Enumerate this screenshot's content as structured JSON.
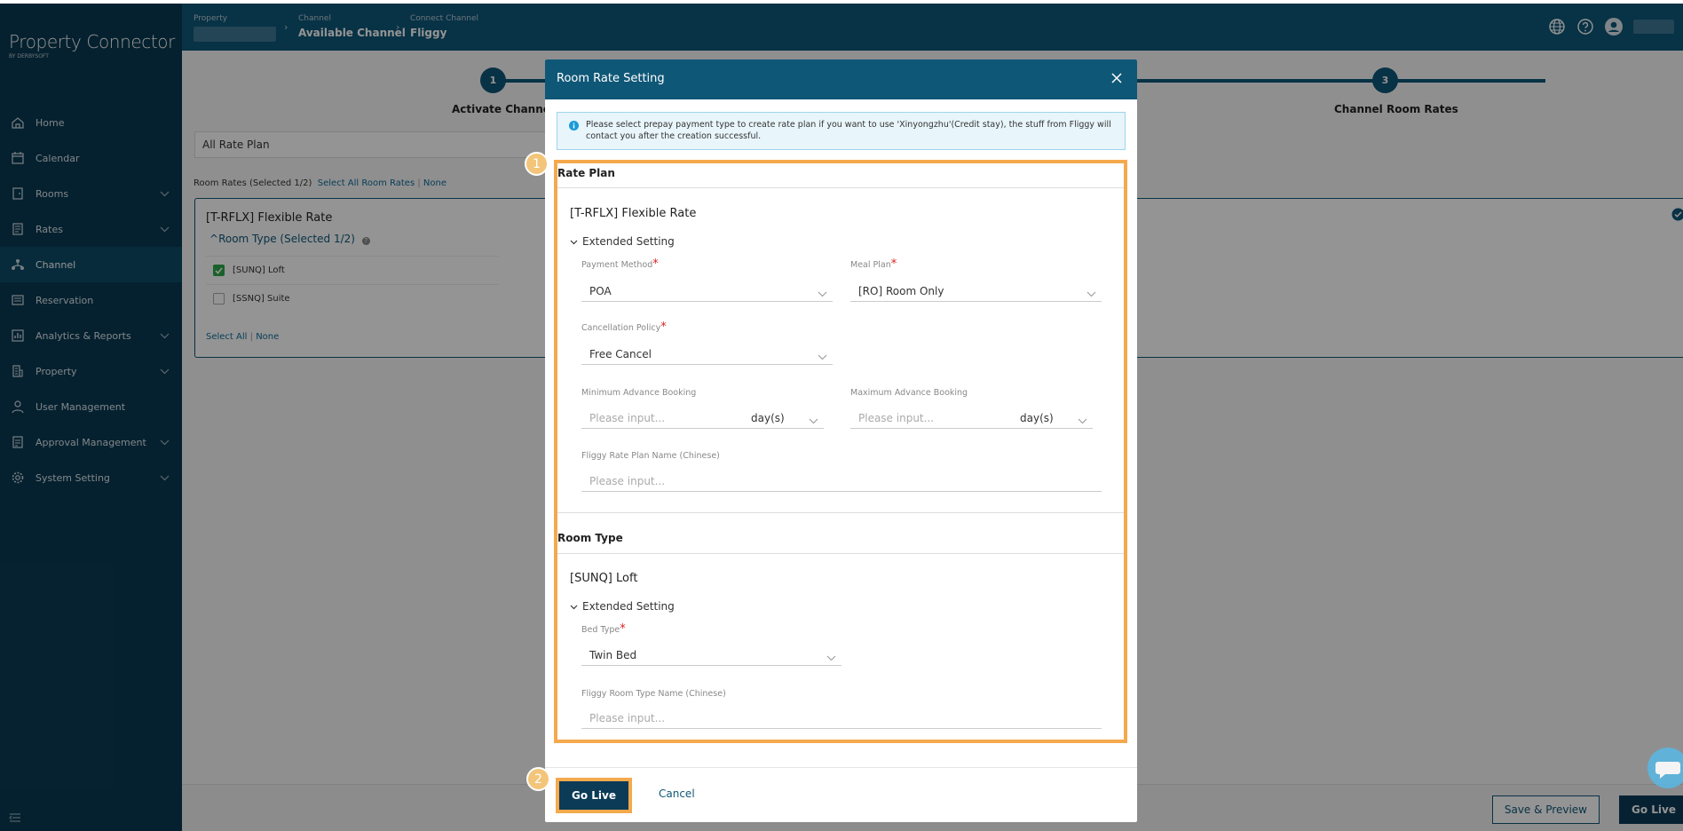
{
  "app": {
    "logo_name": "Property Connector",
    "logo_by": "BY DERBYSOFT"
  },
  "sidebar": {
    "items": [
      {
        "label": "Home",
        "icon": "home-icon",
        "chevron": false,
        "active": false
      },
      {
        "label": "Calendar",
        "icon": "calendar-icon",
        "chevron": false,
        "active": false
      },
      {
        "label": "Rooms",
        "icon": "door-icon",
        "chevron": true,
        "active": false
      },
      {
        "label": "Rates",
        "icon": "rates-icon",
        "chevron": true,
        "active": false
      },
      {
        "label": "Channel",
        "icon": "channel-icon",
        "chevron": false,
        "active": true
      },
      {
        "label": "Reservation",
        "icon": "reservation-icon",
        "chevron": false,
        "active": false
      },
      {
        "label": "Analytics & Reports",
        "icon": "analytics-icon",
        "chevron": true,
        "active": false
      },
      {
        "label": "Property",
        "icon": "building-icon",
        "chevron": true,
        "active": false
      },
      {
        "label": "User Management",
        "icon": "user-icon",
        "chevron": false,
        "active": false
      },
      {
        "label": "Approval Management",
        "icon": "approval-icon",
        "chevron": true,
        "active": false
      },
      {
        "label": "System Setting",
        "icon": "gear-icon",
        "chevron": true,
        "active": false
      }
    ]
  },
  "breadcrumb": {
    "property_label": "Property",
    "channel_label": "Channel",
    "channel_value": "Available Channel",
    "connect_label": "Connect Channel",
    "connect_value": "Fliggy"
  },
  "stepper": {
    "step1_num": "1",
    "step1_label": "Activate Channel",
    "step3_num": "3",
    "step3_label": "Channel Room Rates"
  },
  "background": {
    "rate_plan_select": "All Rate Plan",
    "room_rates_text": "Room Rates (Selected 1/2)",
    "select_all_room_rates": "Select All Room Rates",
    "sep": "|",
    "none": "None",
    "card_title": "[T-RFLX] Flexible Rate",
    "room_type_toggle": "Room Type (Selected 1/2)",
    "rooms": [
      {
        "label": "[SUNQ] Loft",
        "checked": true
      },
      {
        "label": "[SSNQ] Suite",
        "checked": false
      }
    ],
    "select_all": "Select All",
    "none2": "None",
    "save_preview": "Save & Preview",
    "go_live": "Go Live"
  },
  "modal": {
    "title": "Room Rate Setting",
    "info": "Please select prepay payment type to create rate plan if you want to use 'Xinyongzhu'(Credit stay), the stuff from Fliggy will contact you after the creation successful.",
    "badge1": "1",
    "badge2": "2",
    "rate_plan_section": "Rate Plan",
    "rate_plan_name": "[T-RFLX] Flexible Rate",
    "extended_setting": "Extended Setting",
    "payment_method_label": "Payment Method",
    "payment_method_value": "POA",
    "meal_plan_label": "Meal Plan",
    "meal_plan_value": "[RO] Room Only",
    "cancellation_label": "Cancellation Policy",
    "cancellation_value": "Free Cancel",
    "min_adv_label": "Minimum Advance Booking",
    "max_adv_label": "Maximum Advance Booking",
    "placeholder": "Please input...",
    "unit": "day(s)",
    "fliggy_rp_label": "Fliggy Rate Plan Name (Chinese)",
    "room_type_section": "Room Type",
    "room_type_name": "[SUNQ] Loft",
    "bed_type_label": "Bed Type",
    "bed_type_value": "Twin Bed",
    "fliggy_rt_label": "Fliggy Room Type Name (Chinese)",
    "go_live": "Go Live",
    "cancel": "Cancel",
    "required_mark": "*"
  },
  "colors": {
    "brand": "#0f5777",
    "sidebar": "#0a3a52",
    "highlight": "#f5a94d",
    "badge": "#f3c57a"
  }
}
